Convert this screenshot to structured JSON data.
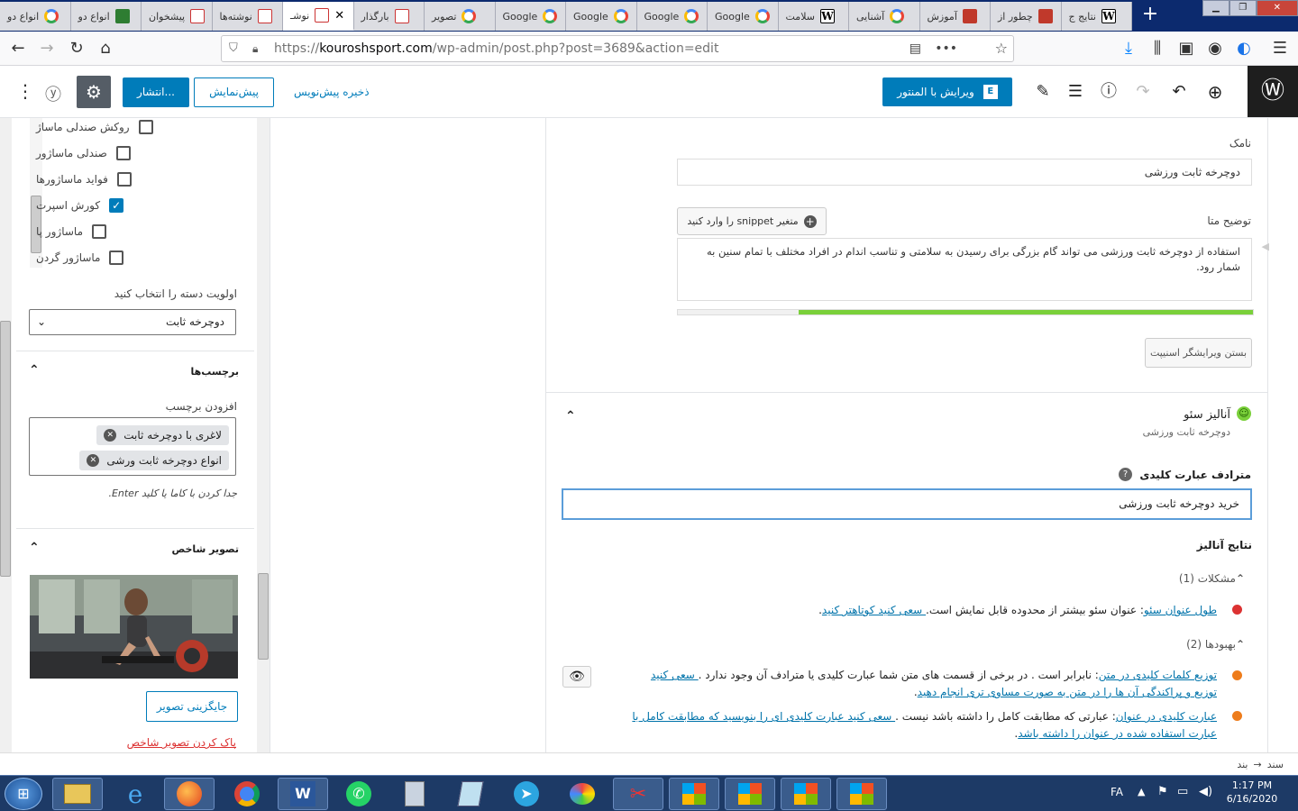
{
  "browser": {
    "tabs": [
      {
        "label": "نتایج ج",
        "icon": "wikipedia-icon"
      },
      {
        "label": "چطور از",
        "icon": "generic-site-icon"
      },
      {
        "label": "آموزش",
        "icon": "generic-site-icon"
      },
      {
        "label": "آشنایی",
        "icon": "google-icon"
      },
      {
        "label": "سلامت",
        "icon": "wikipedia-icon"
      },
      {
        "label": "Google",
        "icon": "google-icon"
      },
      {
        "label": "Google",
        "icon": "google-icon"
      },
      {
        "label": "Google",
        "icon": "google-icon"
      },
      {
        "label": "Google",
        "icon": "google-icon"
      },
      {
        "label": "تصویر",
        "icon": "google-icon"
      },
      {
        "label": "بارگذار",
        "icon": "wordpress-site-icon"
      },
      {
        "label": "نوشـ",
        "icon": "wordpress-site-icon"
      },
      {
        "label": "نوشته‌ها",
        "icon": "wordpress-site-icon"
      },
      {
        "label": "پیشخوان",
        "icon": "wordpress-site-icon"
      },
      {
        "label": "انواع دو",
        "icon": "leaf-site-icon"
      },
      {
        "label": "انواع دو",
        "icon": "google-icon"
      }
    ],
    "active_tab_index": 11,
    "url_domain": "kouroshsport.com",
    "url_prefix": "https://",
    "url_path": "/wp-admin/post.php?post=3689&action=edit"
  },
  "toolbar": {
    "elementor_label": "ویرایش با المنتور",
    "publish_label": "انتشار...",
    "preview_label": "پیش‌نمایش",
    "save_draft_label": "ذخیره پیش‌نویس"
  },
  "sidebar": {
    "categories": [
      {
        "label": "روکش صندلی ماساژ",
        "checked": false
      },
      {
        "label": "صندلی ماساژور",
        "checked": false
      },
      {
        "label": "فواید ماساژورها",
        "checked": false
      },
      {
        "label": "کورش اسپرت",
        "checked": true
      },
      {
        "label": "ماساژور پا",
        "checked": false
      },
      {
        "label": "ماساژور گردن",
        "checked": false
      }
    ],
    "primary_category_label": "اولویت دسته را انتخاب کنید",
    "primary_category_value": "دوچرخه ثابت",
    "tags_title": "برچسب‌ها",
    "add_tag_label": "افزودن برچسب",
    "tags": [
      "لاغری با دوچرخه ثابت",
      "انواع دوچرخه ثابت ورشی"
    ],
    "tags_hint": "جدا کردن با کاما یا کلید Enter.",
    "featured_title": "تصویر شاخص",
    "replace_image_label": "جایگزینی تصویر",
    "remove_image_label": "پاک کردن تصویر شاخص"
  },
  "snippet": {
    "slug_label": "نامک",
    "slug_value": "دوچرخه ثابت ورزشی",
    "meta_label": "توضیح متا",
    "insert_variable_label": "متغیر snippet را وارد کنید",
    "meta_value": "استفاده از دوچرخه ثابت ورزشی می تواند گام بزرگی برای رسیدن به سلامتی و تناسب اندام در افراد مختلف با تمام سنین به شمار رود.",
    "meta_progress": 0.79,
    "close_editor_label": "بستن ویرایشگر اسنیپت"
  },
  "seo": {
    "title": "آنالیز سئو",
    "subtitle": "دوچرخه ثابت ورزشی",
    "synonyms_label": "مترادف عبارت کلیدی",
    "synonyms_value": "خرید دوچرخه ثابت ورزشی",
    "results_title": "نتایج آنالیز",
    "problems_label": "مشکلات (1)",
    "improvements_label": "بهبودها (2)",
    "problem_1_link": "طول عنوان سئو",
    "problem_1_text": ": عنوان سئو بیشتر از محدوده قابل نمایش است.",
    "problem_1_action": " سعی کنید کوتاهتر کنید",
    "improvement_1_link": "توزیع کلمات کلیدی در متن",
    "improvement_1_text": ": نابرابر است . در برخی از قسمت های متن شما عبارت کلیدی یا مترادف آن وجود ندارد .",
    "improvement_1_action": " سعی کنید",
    "improvement_1_action2": "توزیع و پراکندگی آن ها را در متن به صورت مساوی تری انجام دهید",
    "improvement_2_link": "عبارت کلیدی در عنوان",
    "improvement_2_text": ": عبارتی که مطابقت کامل را داشته باشد نیست .",
    "improvement_2_action": " سعی کنید عبارت کلیدی ای را بنویسید که مطابقت کامل با",
    "improvement_2_action2": "عبارت استفاده شده در عنوان را داشته باشد"
  },
  "statusbar": {
    "breadcrumb_1": "سند",
    "arrow": "→",
    "breadcrumb_2": "بند"
  },
  "taskbar": {
    "lang": "FA",
    "time": "1:17 PM",
    "date": "6/16/2020"
  },
  "colors": {
    "wp_blue": "#007cba",
    "link": "#0073aa",
    "good": "#7ad03a",
    "bad": "#dc3232",
    "ok": "#ee7c1b"
  }
}
